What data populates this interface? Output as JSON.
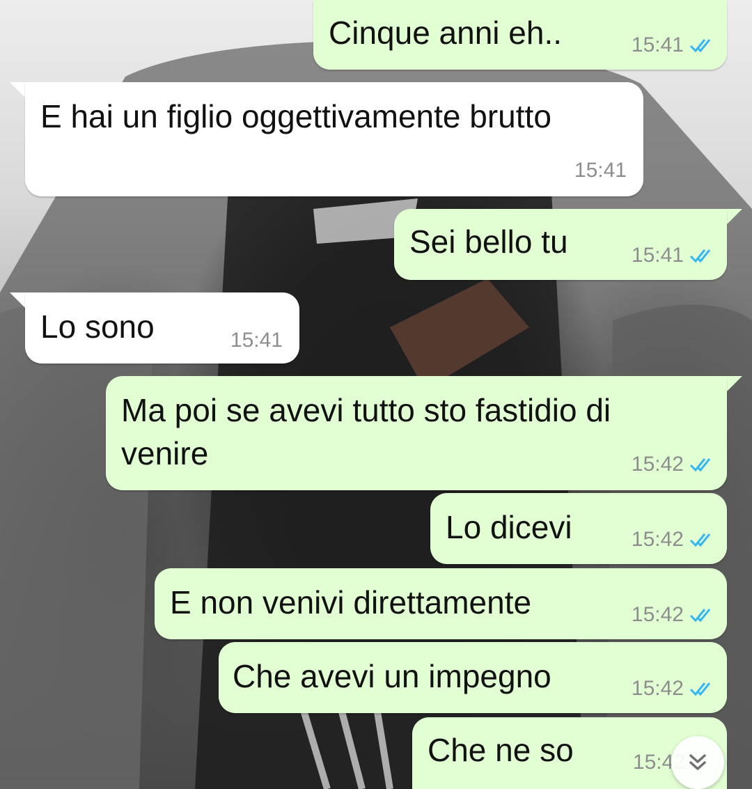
{
  "messages": [
    {
      "direction": "outgoing",
      "text": "Cinque anni eh..",
      "time": "15:41",
      "status": "read"
    },
    {
      "direction": "incoming",
      "text": "E hai un figlio oggettivamente brutto",
      "time": "15:41"
    },
    {
      "direction": "outgoing",
      "text": "Sei bello tu",
      "time": "15:41",
      "status": "read"
    },
    {
      "direction": "incoming",
      "text": "Lo sono",
      "time": "15:41"
    },
    {
      "direction": "outgoing",
      "text_line1": "Ma poi se avevi tutto sto fastidio di",
      "text_line2": "venire",
      "time": "15:42",
      "status": "read"
    },
    {
      "direction": "outgoing",
      "text": "Lo dicevi",
      "time": "15:42",
      "status": "read"
    },
    {
      "direction": "outgoing",
      "text": "E non venivi direttamente",
      "time": "15:42",
      "status": "read"
    },
    {
      "direction": "outgoing",
      "text": "Che avevi un impegno",
      "time": "15:42",
      "status": "read"
    },
    {
      "direction": "outgoing",
      "text": "Che ne so",
      "time": "15:42",
      "status": "read"
    }
  ],
  "colors": {
    "outgoing_bubble": "#e2ffd4",
    "incoming_bubble": "#ffffff",
    "read_ticks": "#34b7f1",
    "timestamp": "#8d8d8d"
  },
  "icons": {
    "read_receipt": "double-check-icon",
    "scroll_down": "double-chevron-down-icon"
  }
}
